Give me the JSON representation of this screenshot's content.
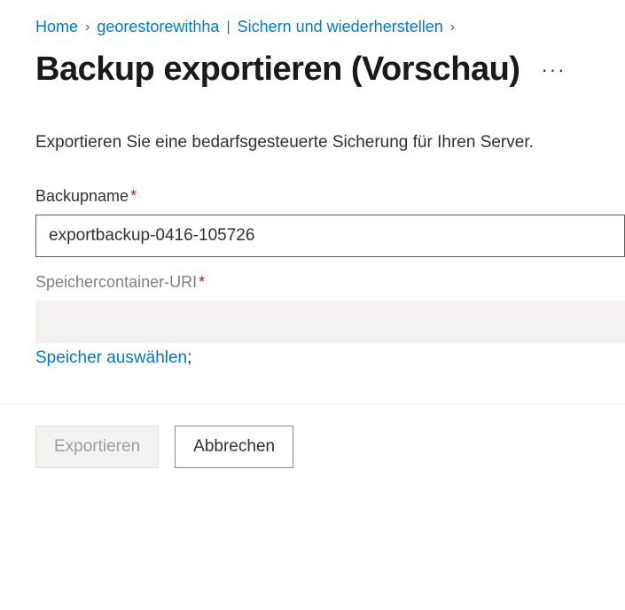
{
  "breadcrumb": {
    "home": "Home",
    "resource": "georestorewithha",
    "section": "Sichern und wiederherstellen"
  },
  "title": "Backup exportieren (Vorschau)",
  "more_label": "···",
  "description": "Exportieren Sie eine bedarfsgesteuerte Sicherung für Ihren Server.",
  "form": {
    "backup_name_label": "Backupname",
    "backup_name_value": "exportbackup-0416-105726",
    "storage_uri_label": "Speichercontainer-URI",
    "storage_uri_value": "",
    "select_storage_link": "Speicher auswählen"
  },
  "buttons": {
    "export": "Exportieren",
    "cancel": "Abbrechen"
  }
}
